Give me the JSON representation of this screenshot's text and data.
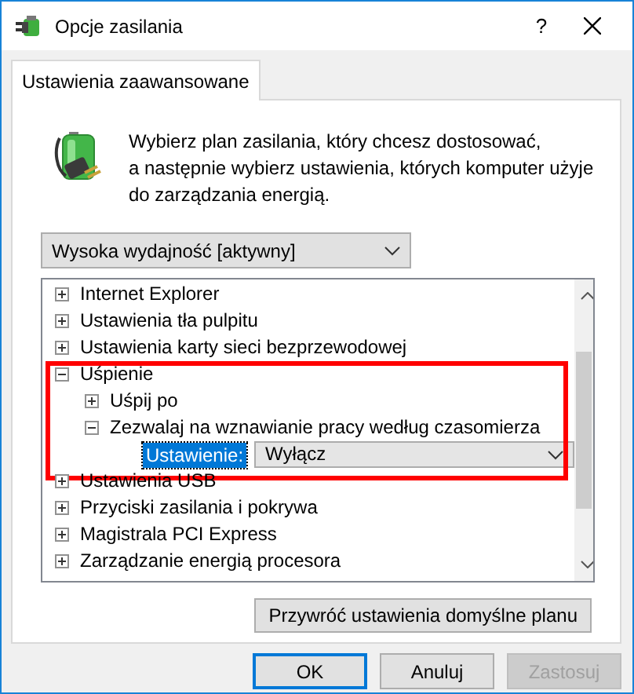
{
  "window": {
    "title": "Opcje zasilania",
    "help": "?"
  },
  "tabs": [
    {
      "label": "Ustawienia zaawansowane",
      "selected": true
    }
  ],
  "description": "Wybierz plan zasilania, który chcesz dostosować,\na następnie wybierz ustawienia, których komputer użyje\ndo zarządzania energią.",
  "plan_select": {
    "value": "Wysoka wydajność [aktywny]"
  },
  "tree": [
    {
      "kind": "node",
      "label": "Internet Explorer",
      "expanded": false
    },
    {
      "kind": "node",
      "label": "Ustawienia tła pulpitu",
      "expanded": false
    },
    {
      "kind": "node",
      "label": "Ustawienia karty sieci bezprzewodowej",
      "expanded": false
    },
    {
      "kind": "node",
      "label": "Uśpienie",
      "expanded": true,
      "highlighted": true,
      "children": [
        {
          "kind": "node",
          "label": "Uśpij po",
          "expanded": false
        },
        {
          "kind": "node",
          "label": "Zezwalaj na wznawianie pracy według czasomierza",
          "expanded": true,
          "children": [
            {
              "kind": "setting",
              "label": "Ustawienie:",
              "value": "Wyłącz",
              "selected": true
            }
          ]
        }
      ]
    },
    {
      "kind": "node",
      "label": "Ustawienia USB",
      "expanded": false
    },
    {
      "kind": "node",
      "label": "Przyciski zasilania i pokrywa",
      "expanded": false
    },
    {
      "kind": "node",
      "label": "Magistrala PCI Express",
      "expanded": false
    },
    {
      "kind": "node",
      "label": "Zarządzanie energią procesora",
      "expanded": false
    }
  ],
  "restore_button": "Przywróć ustawienia domyślne planu",
  "buttons": [
    {
      "label": "OK",
      "default": true,
      "disabled": false
    },
    {
      "label": "Anuluj",
      "default": false,
      "disabled": false
    },
    {
      "label": "Zastosuj",
      "default": false,
      "disabled": true
    }
  ]
}
